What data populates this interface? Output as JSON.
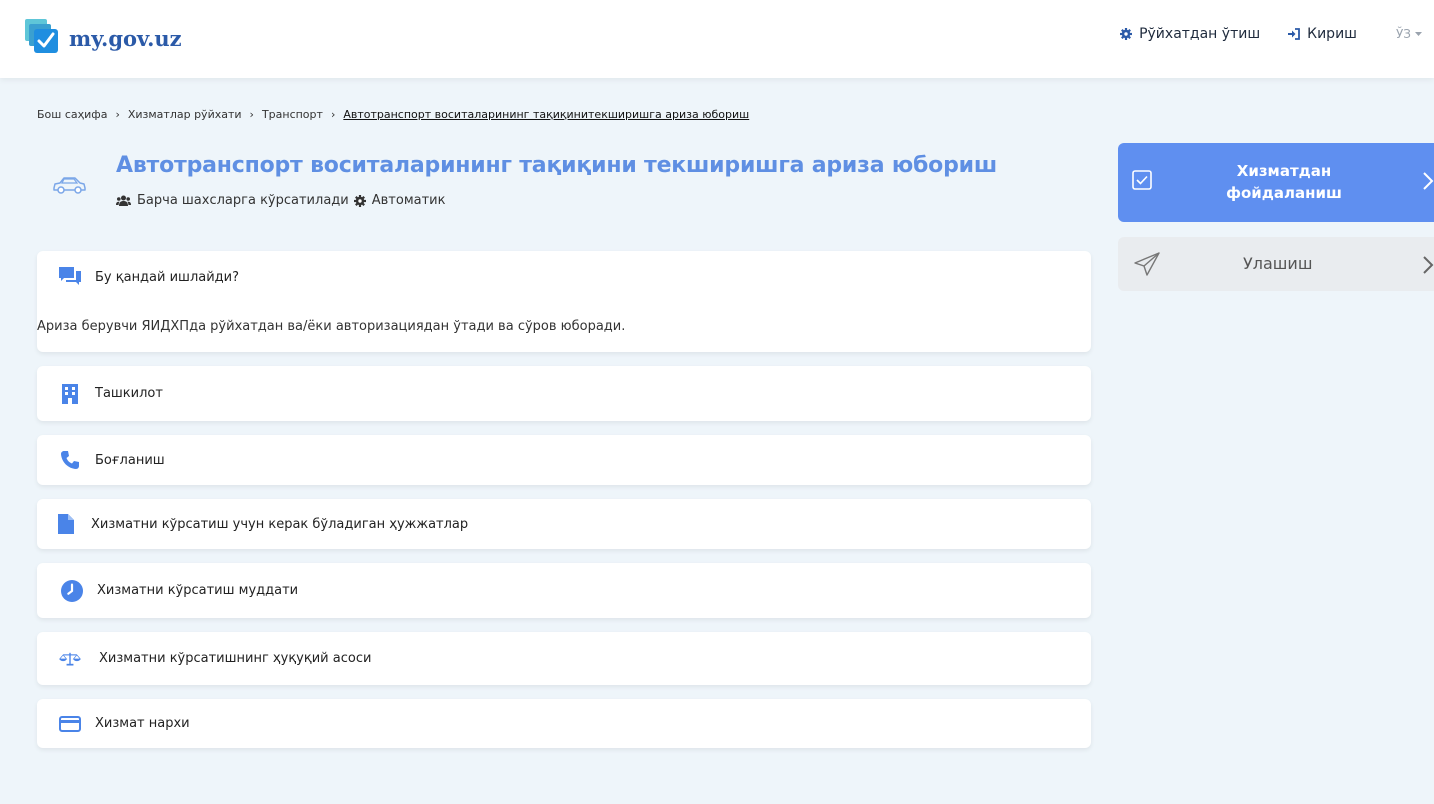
{
  "header": {
    "logo_text": "my.gov.uz",
    "register_label": "Рўйхатдан ўтиш",
    "login_label": "Кириш",
    "language_label": "ЎЗ"
  },
  "breadcrumb": {
    "items": [
      "Бош саҳифа",
      "Хизматлар рўйхати",
      "Транспорт"
    ],
    "current": "Автотранспорт воситаларининг тақиқинитекширишга ариза юбориш"
  },
  "service": {
    "title": "Автотранспорт воситаларининг тақиқини текширишга ариза юбориш",
    "audience": "Барча шахсларга кўрсатилади",
    "mode": "Автоматик"
  },
  "sections": {
    "how_it_works": {
      "label": "Бу қандай ишлайди?",
      "text": "Ариза берувчи ЯИДХПда рўйхатдан ва/ёки авторизациядан ўтади ва сўров юборади."
    },
    "organization": {
      "label": "Ташкилот"
    },
    "contact": {
      "label": "Боғланиш"
    },
    "documents": {
      "label": "Хизматни кўрсатиш учун керак бўладиган ҳужжатлар"
    },
    "duration": {
      "label": "Хизматни кўрсатиш муддати"
    },
    "legal_basis": {
      "label": "Хизматни кўрсатишнинг ҳуқуқий асоси"
    },
    "price": {
      "label": "Хизмат нархи"
    }
  },
  "sidebar": {
    "use_service_label": "Хизматдан фойдаланиш",
    "share_label": "Улашиш"
  },
  "colors": {
    "accent": "#5f8ff0",
    "title": "#5f8fe3",
    "icon": "#4a84e8",
    "background": "#eef5fa"
  }
}
